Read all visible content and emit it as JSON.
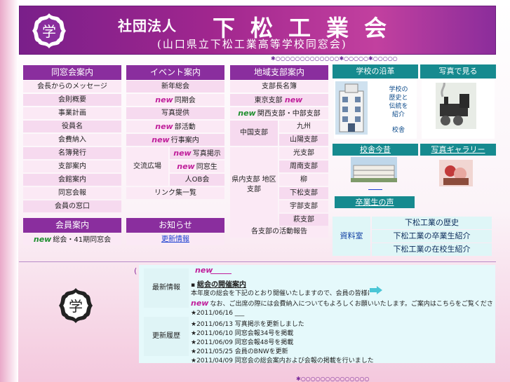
{
  "header": {
    "org_type": "社団法人",
    "org_name": "下松工業会",
    "org_sub": "(山口県立下松工業高等学校同窓会)",
    "notice": "✱○○○○○○○○○○○○○✱○○○○○✱○○○○○"
  },
  "col1": {
    "title": "同窓会案内",
    "items": [
      "会長からのメッセージ",
      "会則概要",
      "事業計画",
      "役員名",
      "会費納入",
      "名簿発行",
      "支部案内",
      "会館案内",
      "同窓会報",
      "会員の窓口"
    ]
  },
  "col1b": {
    "title": "会員案内",
    "item": "総会・41期同窓会",
    "new": "new"
  },
  "col2": {
    "title": "イベント案内",
    "items": [
      "新年総会",
      "同期会",
      "写真提供",
      "部活動",
      "行事案内"
    ],
    "sub_label": "交流広場",
    "sub_items": [
      "写真掲示",
      "同窓生",
      "人OB会"
    ],
    "last": "リンク集一覧",
    "new": "new"
  },
  "col2b": {
    "title": "お知らせ",
    "item": "更新情報"
  },
  "col3": {
    "title": "地域支部案内",
    "first": "支部長名簿",
    "second": "東京支部",
    "second_new": "new",
    "third": "関西支部・中部支部",
    "third_new": "new",
    "group1_label": "中国支部",
    "group1_items": [
      "九州",
      "山陽支部"
    ],
    "group2_label": "県内支部 地区支部",
    "group2_items": [
      "光支部",
      "周南支部",
      "柳",
      "下松支部",
      "宇部支部",
      "萩支部"
    ],
    "last": "各支部の活動報告"
  },
  "teal": {
    "head1": "学校の沿革",
    "head2": "写真で見る",
    "text1": [
      "学校の",
      "歴史と",
      "伝統を",
      "紹介",
      "校舎"
    ],
    "head3": "校舎今昔",
    "head4": "写真ギャラリー",
    "head5": "卒業生の声",
    "side_label": "資料室",
    "side_items": [
      "下松工業の歴史",
      "下松工業の卒業生紹介",
      "下松工業の在校生紹介"
    ]
  },
  "news": {
    "title_tag": "(",
    "new": "new",
    "label1": "最新情報",
    "label2": "更新履歴",
    "headline": "総会の開催案内",
    "line1": "本年度の総会を下記のとおり開催いたしますので、会員の皆様にはご出席くださいますようお願いいたします。",
    "line2": "なお、ご出席の際には会費納入についてもよろしくお願いいたします。ご案内はこちらをご覧ください。",
    "updates": [
      "★2011/06/16 ___",
      "★2011/06/13 写真掲示を更新しました",
      "★2011/06/10 同窓会報34号を掲載",
      "★2011/06/09 同窓会報48号を掲載",
      "★2011/05/25 会員のBNWを更新",
      "★2011/04/09 同窓会の総会案内および会報の掲載を行いました"
    ]
  },
  "footer": {
    "notice": "✱○○○○○○○○○○○○○○"
  }
}
